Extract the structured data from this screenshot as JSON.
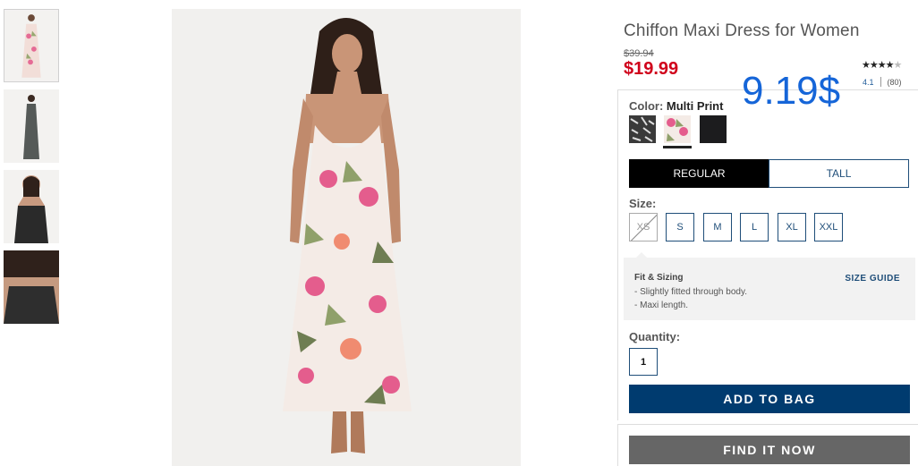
{
  "product": {
    "title": "Chiffon Maxi Dress for Women",
    "original_price": "$39.94",
    "sale_price": "$19.99",
    "overlay_price": "9.19$",
    "rating_stars": 4,
    "rating_max": 5,
    "rating_value": "4.1",
    "review_count": "(80)"
  },
  "color": {
    "label": "Color:",
    "selected": "Multi Print",
    "swatches": [
      {
        "name": "black-white-print",
        "selected": false
      },
      {
        "name": "multi-print",
        "selected": true
      },
      {
        "name": "black",
        "selected": false
      }
    ]
  },
  "fit": {
    "options": [
      "REGULAR",
      "TALL"
    ],
    "selected": "REGULAR"
  },
  "size": {
    "label": "Size:",
    "options": [
      "XS",
      "S",
      "M",
      "L",
      "XL",
      "XXL"
    ],
    "unavailable": [
      "XS"
    ]
  },
  "fit_sizing": {
    "title": "Fit & Sizing",
    "size_guide": "SIZE GUIDE",
    "lines": [
      "- Slightly fitted through body.",
      "- Maxi length."
    ]
  },
  "quantity": {
    "label": "Quantity:",
    "value": "1"
  },
  "actions": {
    "add_to_bag": "ADD TO BAG",
    "find_it_now": "FIND IT NOW"
  },
  "icons": {
    "star_full": "★",
    "star_empty": "★"
  },
  "colors": {
    "sale_red": "#d0021b",
    "navy": "#003b6f",
    "link_blue": "#1f4e79",
    "overlay_blue": "#1565d8",
    "find_gray": "#666666"
  }
}
